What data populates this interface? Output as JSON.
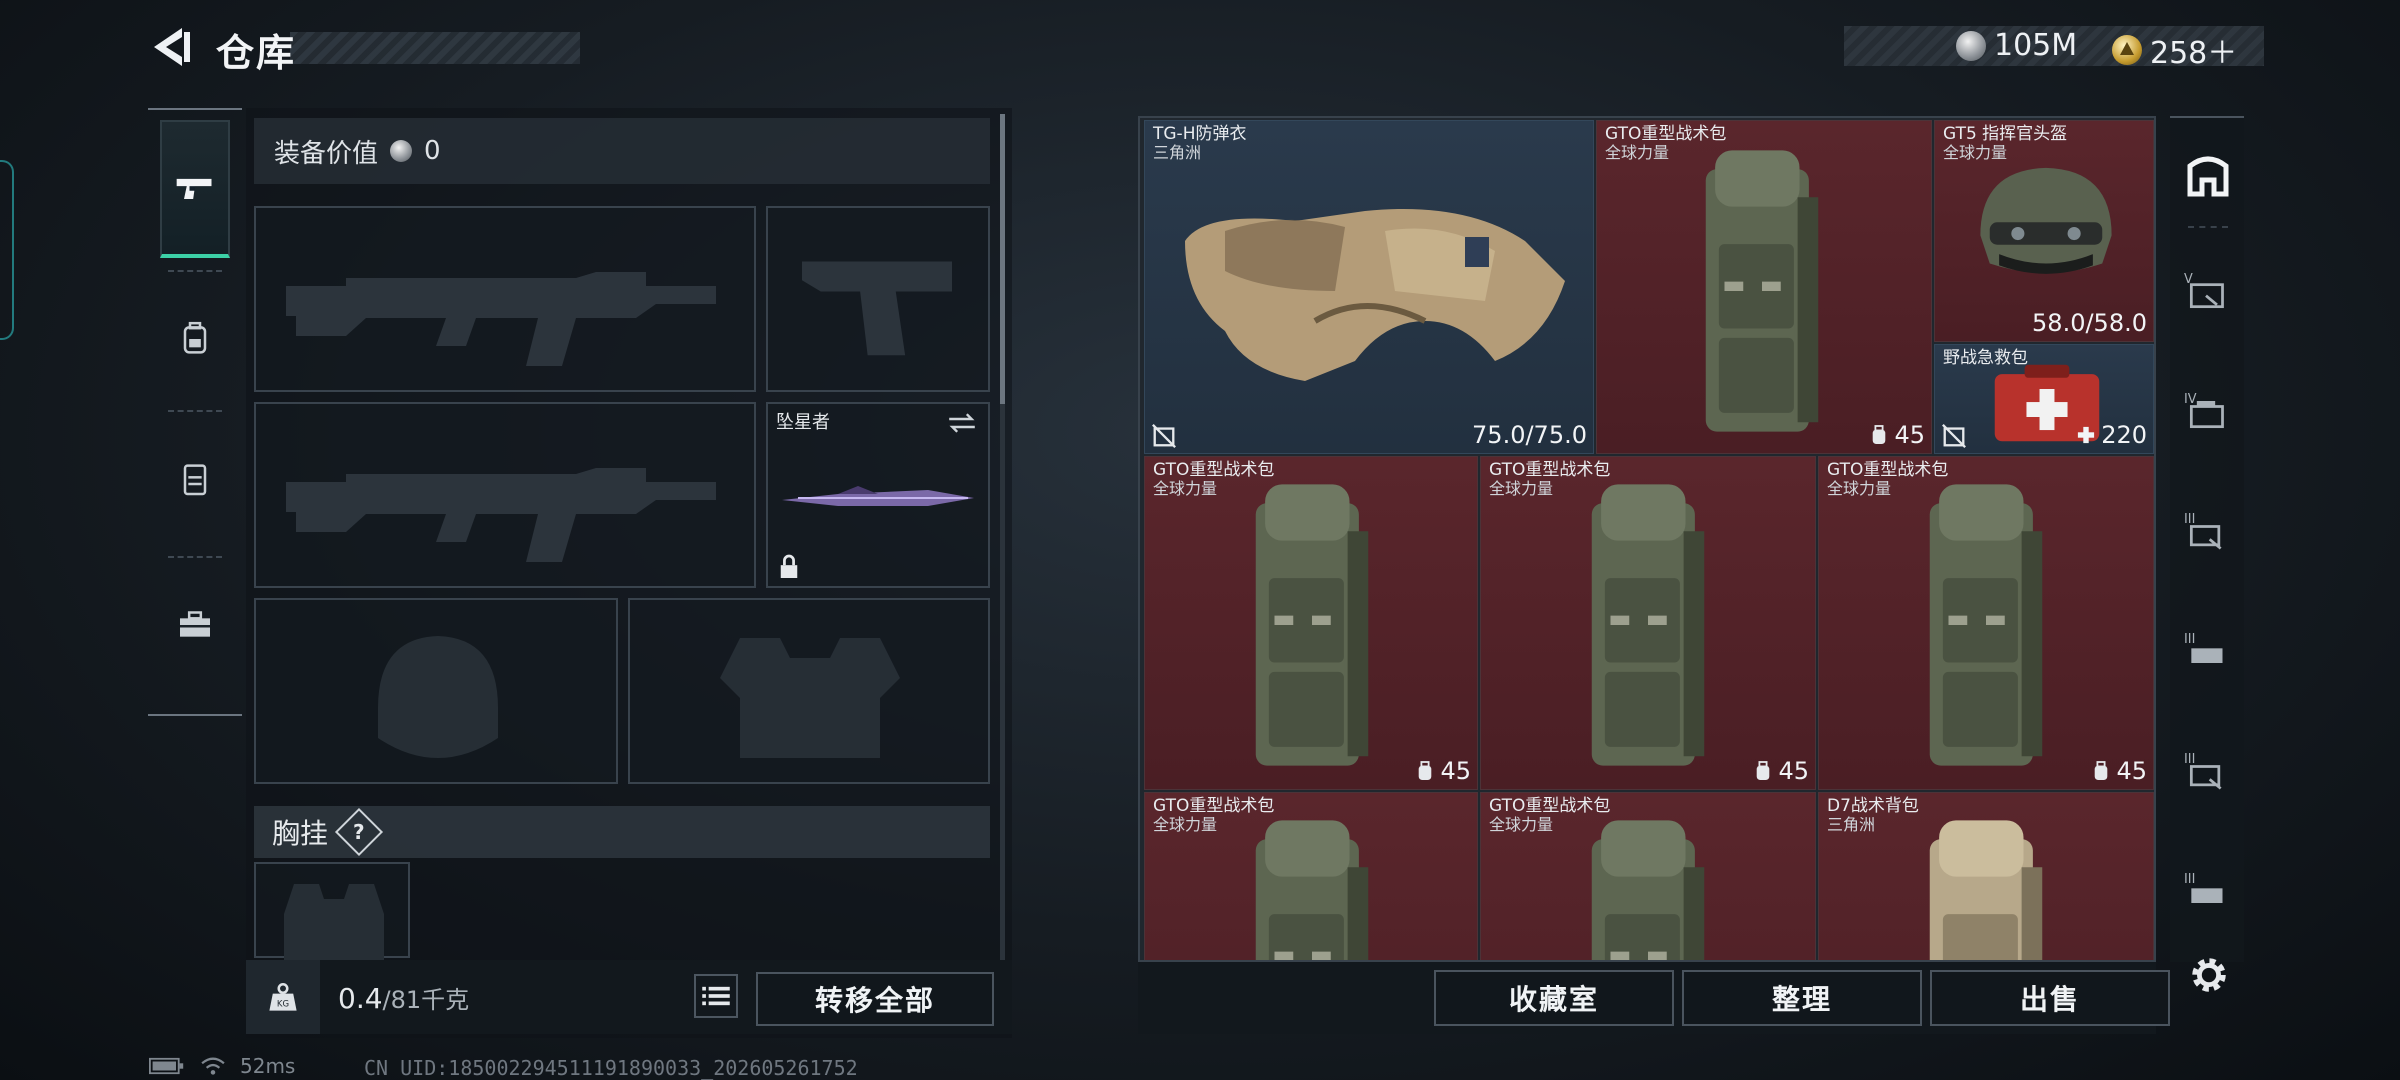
{
  "header": {
    "title": "仓库",
    "currencies": [
      {
        "icon": "silver-coin-icon",
        "value": "105M"
      },
      {
        "icon": "gold-coin-icon",
        "value": "258＋"
      }
    ]
  },
  "rail": {
    "tabs": [
      {
        "name": "weapon-tab",
        "icon": "pistol-icon",
        "active": true
      },
      {
        "name": "backpack-tab",
        "icon": "backpack-icon",
        "active": false
      },
      {
        "name": "container-tab",
        "icon": "canister-icon",
        "active": false
      },
      {
        "name": "toolbox-tab",
        "icon": "toolbox-icon",
        "active": false
      }
    ]
  },
  "equipment": {
    "value_label": "装备价值",
    "value": "0",
    "melee": {
      "name": "坠星者",
      "locked": true
    },
    "rig_label": "胸挂",
    "rig_help": "?"
  },
  "footer_left": {
    "weight_current": "0.4",
    "weight_max": "/81千克",
    "transfer_all": "转移全部"
  },
  "stash": {
    "items": [
      {
        "name": "TG-H防弹衣",
        "sub": "三角洲",
        "value": "75.0/75.0",
        "type": "vest",
        "bg": "blue",
        "lock": true,
        "badge": ""
      },
      {
        "name": "GTO重型战术包",
        "sub": "全球力量",
        "value": "45",
        "type": "pack",
        "bg": "red",
        "lock": false,
        "badge": "bag"
      },
      {
        "name": "GT5 指挥官头盔",
        "sub": "全球力量",
        "value": "58.0/58.0",
        "type": "helmet",
        "bg": "red",
        "lock": false,
        "badge": ""
      },
      {
        "name": "野战急救包",
        "sub": "",
        "value": "220",
        "type": "medkit",
        "bg": "blue",
        "lock": true,
        "badge": "plus"
      },
      {
        "name": "GTO重型战术包",
        "sub": "全球力量",
        "value": "45",
        "type": "pack",
        "bg": "red",
        "lock": false,
        "badge": "bag"
      },
      {
        "name": "GTO重型战术包",
        "sub": "全球力量",
        "value": "45",
        "type": "pack",
        "bg": "red",
        "lock": false,
        "badge": "bag"
      },
      {
        "name": "GTO重型战术包",
        "sub": "全球力量",
        "value": "45",
        "type": "pack",
        "bg": "red",
        "lock": false,
        "badge": "bag"
      },
      {
        "name": "GTO重型战术包",
        "sub": "全球力量",
        "value": "",
        "type": "pack",
        "bg": "red",
        "lock": false,
        "badge": ""
      },
      {
        "name": "GTO重型战术包",
        "sub": "全球力量",
        "value": "",
        "type": "pack",
        "bg": "red",
        "lock": false,
        "badge": ""
      },
      {
        "name": "D7战术背包",
        "sub": "三角洲",
        "value": "",
        "type": "pack-tan",
        "bg": "red",
        "lock": false,
        "badge": ""
      }
    ]
  },
  "footer_right": {
    "collection": "收藏室",
    "sort": "整理",
    "sell": "出售"
  },
  "status": {
    "ping": "52ms",
    "uid": "CN UID:185002294511191890033_202605261752"
  },
  "colors": {
    "accent": "#3cd1a7",
    "item_red": "#4e2026",
    "item_blue": "#26354a"
  }
}
